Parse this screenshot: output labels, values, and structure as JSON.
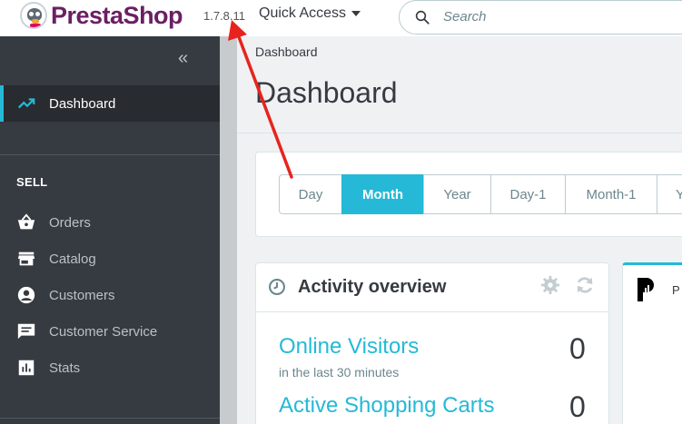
{
  "header": {
    "brand": "PrestaShop",
    "version": "1.7.8.11",
    "quick_access": "Quick Access",
    "search_placeholder": "Search"
  },
  "sidebar": {
    "collapse_glyph": "«",
    "active_item": "Dashboard",
    "section_sell": "SELL",
    "items": [
      {
        "label": "Orders",
        "icon": "basket-icon"
      },
      {
        "label": "Catalog",
        "icon": "store-icon"
      },
      {
        "label": "Customers",
        "icon": "account-circle-icon"
      },
      {
        "label": "Customer Service",
        "icon": "chat-icon"
      },
      {
        "label": "Stats",
        "icon": "bar-chart-icon"
      }
    ]
  },
  "main": {
    "breadcrumb": "Dashboard",
    "title": "Dashboard",
    "periods": [
      "Day",
      "Month",
      "Year",
      "Day-1",
      "Month-1",
      "Y"
    ],
    "active_period": "Month",
    "activity": {
      "title": "Activity overview",
      "online_visitors_label": "Online Visitors",
      "online_visitors_sub": "in the last 30 minutes",
      "online_visitors_value": "0",
      "active_carts_label": "Active Shopping Carts",
      "active_carts_value": "0"
    },
    "side_card_letter": "P"
  },
  "colors": {
    "accent": "#25b9d7",
    "sidebar_bg": "#363a41",
    "brand_purple": "#6b1f63",
    "annotation_arrow": "#e8231e"
  }
}
